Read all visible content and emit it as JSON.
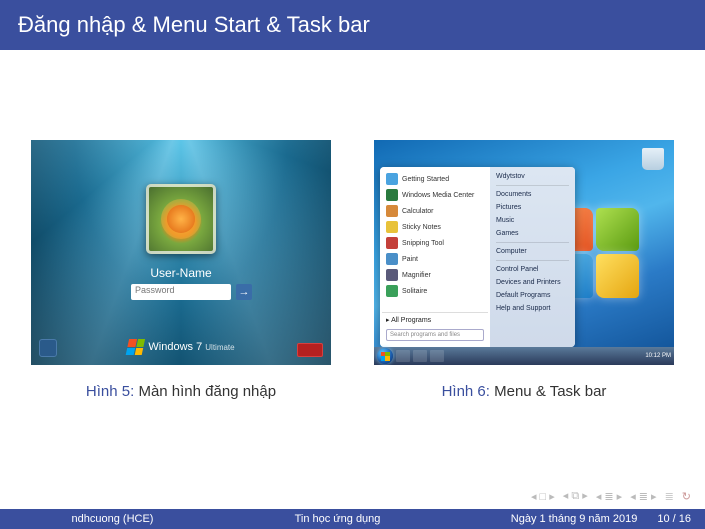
{
  "title": "Đăng nhập & Menu Start & Task bar",
  "figure1": {
    "label": "Hình 5:",
    "caption": "Màn hình đăng nhập",
    "username": "User-Name",
    "password_placeholder": "Password",
    "brand": "Windows 7",
    "edition": "Ultimate"
  },
  "figure2": {
    "label": "Hình 6:",
    "caption": "Menu & Task bar",
    "start_left": [
      "Getting Started",
      "Windows Media Center",
      "Calculator",
      "Sticky Notes",
      "Snipping Tool",
      "Paint",
      "Magnifier",
      "Solitaire"
    ],
    "all_programs": "All Programs",
    "search_placeholder": "Search programs and files",
    "start_right": [
      "Wdytstov",
      "Documents",
      "Pictures",
      "Music",
      "Games",
      "Computer",
      "Control Panel",
      "Devices and Printers",
      "Default Programs",
      "Help and Support"
    ],
    "clock": "10:12 PM"
  },
  "start_icon_colors": [
    "#4aa3e0",
    "#2a7a3f",
    "#d6893a",
    "#e8c23a",
    "#c4403a",
    "#4a8fc8",
    "#5a5a7a",
    "#3aa05a"
  ],
  "footer": {
    "author": "ndhcuong (HCE)",
    "course": "Tin học ứng dụng",
    "date": "Ngày 1 tháng 9 năm 2019",
    "page": "10 / 16"
  }
}
